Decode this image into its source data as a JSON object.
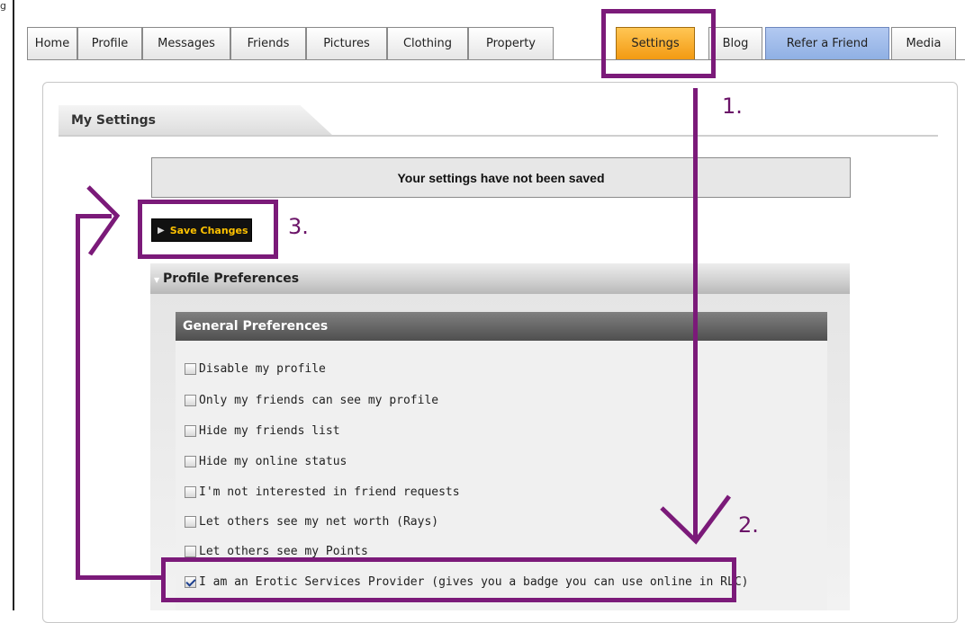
{
  "top_fragment": "g",
  "tabs": [
    {
      "label": "Home"
    },
    {
      "label": "Profile"
    },
    {
      "label": "Messages"
    },
    {
      "label": "Friends"
    },
    {
      "label": "Pictures"
    },
    {
      "label": "Clothing"
    },
    {
      "label": "Property"
    },
    {
      "label": "Settings",
      "active": true
    },
    {
      "label": "Blog"
    },
    {
      "label": "Refer a Friend"
    },
    {
      "label": "Media"
    }
  ],
  "page": {
    "section_title": "My Settings",
    "status_message": "Your settings have not been saved",
    "save_button_label": "Save Changes",
    "profile_preferences_title": "Profile Preferences",
    "general_preferences_title": "General Preferences",
    "options": [
      {
        "label": "Disable my profile",
        "checked": false
      },
      {
        "label": "Only my friends can see my profile",
        "checked": false
      },
      {
        "label": "Hide my friends list",
        "checked": false
      },
      {
        "label": "Hide my online status",
        "checked": false
      },
      {
        "label": "I'm not interested in friend requests",
        "checked": false
      },
      {
        "label": "Let others see my net worth (Rays)",
        "checked": false
      },
      {
        "label": "Let others see my Points",
        "checked": false
      },
      {
        "label": "I am an Erotic Services Provider (gives you a badge you can use online in RLC)",
        "checked": true
      }
    ]
  },
  "annotations": {
    "step1": "1.",
    "step2": "2.",
    "step3": "3.",
    "color": "#7b1a79"
  },
  "colors": {
    "active_tab": "#f5a623",
    "refer_tab": "#9db8e8",
    "save_label": "#ffc200"
  }
}
